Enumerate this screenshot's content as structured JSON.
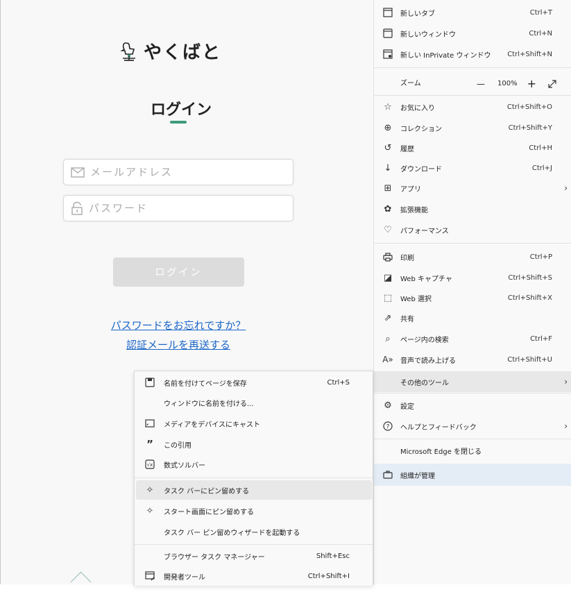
{
  "app": {
    "logo_text": "やくばと"
  },
  "login": {
    "title": "ログイン",
    "email_placeholder": "メールアドレス",
    "password_placeholder": "パスワード",
    "login_button": "ログイン",
    "forgot_link": "パスワードをお忘れですか？",
    "resend_link": "認証メールを再送する"
  },
  "colors": {
    "accent": "#3b9b7a",
    "link": "#1a66c9",
    "selected": "#e4edf6"
  },
  "menu": {
    "items": [
      {
        "label": "新しいタブ",
        "shortcut": "Ctrl+T",
        "icon": "new-tab-icon"
      },
      {
        "label": "新しいウィンドウ",
        "shortcut": "Ctrl+N",
        "icon": "window-icon"
      },
      {
        "label": "新しい InPrivate ウィンドウ",
        "shortcut": "Ctrl+Shift+N",
        "icon": "inprivate-icon"
      },
      {
        "label": "ズーム",
        "shortcut": "",
        "icon": ""
      },
      {
        "label": "お気に入り",
        "shortcut": "Ctrl+Shift+O",
        "icon": "favorites-icon"
      },
      {
        "label": "コレクション",
        "shortcut": "Ctrl+Shift+Y",
        "icon": "collections-icon"
      },
      {
        "label": "履歴",
        "shortcut": "Ctrl+H",
        "icon": "history-icon"
      },
      {
        "label": "ダウンロード",
        "shortcut": "Ctrl+J",
        "icon": "download-icon"
      },
      {
        "label": "アプリ",
        "shortcut": "",
        "icon": "apps-icon"
      },
      {
        "label": "拡張機能",
        "shortcut": "",
        "icon": "extensions-icon"
      },
      {
        "label": "パフォーマンス",
        "shortcut": "",
        "icon": "performance-icon"
      },
      {
        "label": "印刷",
        "shortcut": "Ctrl+P",
        "icon": "print-icon"
      },
      {
        "label": "Web キャプチャ",
        "shortcut": "Ctrl+Shift+S",
        "icon": "web-capture-icon"
      },
      {
        "label": "Web 選択",
        "shortcut": "Ctrl+Shift+X",
        "icon": "web-select-icon"
      },
      {
        "label": "共有",
        "shortcut": "",
        "icon": "share-icon"
      },
      {
        "label": "ページ内の検索",
        "shortcut": "Ctrl+F",
        "icon": "find-icon"
      },
      {
        "label": "音声で読み上げる",
        "shortcut": "Ctrl+Shift+U",
        "icon": "read-aloud-icon"
      },
      {
        "label": "その他のツール",
        "shortcut": "",
        "icon": ""
      },
      {
        "label": "設定",
        "shortcut": "",
        "icon": "settings-icon"
      },
      {
        "label": "ヘルプとフィードバック",
        "shortcut": "",
        "icon": "help-icon"
      },
      {
        "label": "Microsoft Edge を閉じる",
        "shortcut": "",
        "icon": ""
      },
      {
        "label": "組織が管理",
        "shortcut": "",
        "icon": "briefcase-icon"
      }
    ],
    "zoom": {
      "minus": "—",
      "value": "100%",
      "plus": "+"
    }
  },
  "submenu": {
    "items": [
      {
        "label": "名前を付けてページを保存",
        "shortcut": "Ctrl+S",
        "icon": "save-page-icon"
      },
      {
        "label": "ウィンドウに名前を付ける...",
        "shortcut": "",
        "icon": ""
      },
      {
        "label": "メディアをデバイスにキャスト",
        "shortcut": "",
        "icon": "cast-icon"
      },
      {
        "label": "この引用",
        "shortcut": "",
        "icon": "quote-icon"
      },
      {
        "label": "数式ソルバー",
        "shortcut": "",
        "icon": "math-solver-icon"
      },
      {
        "label": "タスク バーにピン留めする",
        "shortcut": "",
        "icon": "pin-icon"
      },
      {
        "label": "スタート画面にピン留めする",
        "shortcut": "",
        "icon": "pin-icon"
      },
      {
        "label": "タスク バー ピン留めウィザードを起動する",
        "shortcut": "",
        "icon": ""
      },
      {
        "label": "ブラウザー タスク マネージャー",
        "shortcut": "Shift+Esc",
        "icon": ""
      },
      {
        "label": "開発者ツール",
        "shortcut": "Ctrl+Shift+I",
        "icon": "dev-tools-icon"
      }
    ]
  }
}
